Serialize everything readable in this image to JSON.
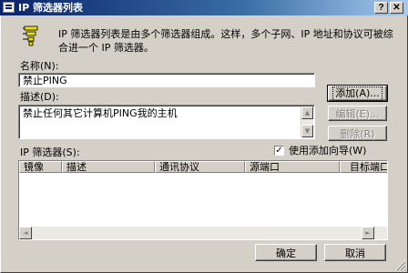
{
  "window": {
    "title": "IP 筛选器列表",
    "help_glyph": "?",
    "close_glyph": "✕"
  },
  "intro": {
    "text": "IP 筛选器列表是由多个筛选器组成。这样，多个子网、IP 地址和协议可被综合进一个 IP 筛选器。"
  },
  "name_field": {
    "label": "名称",
    "shortcut": "(N):",
    "value": "禁止PING"
  },
  "description_field": {
    "label": "描述",
    "shortcut": "(D):",
    "value": "禁止任何其它计算机PING我的主机"
  },
  "buttons": {
    "add": "添加(A)...",
    "edit": "编辑(E)...",
    "remove": "删除(R)",
    "ok": "确定",
    "cancel": "取消"
  },
  "filters": {
    "label": "IP 筛选器",
    "shortcut": "(S):",
    "columns": [
      "镜像",
      "描述",
      "通讯协议",
      "源端口",
      "目标端口"
    ],
    "rows": []
  },
  "wizard": {
    "label": "使用添加向导",
    "shortcut": "(W)",
    "checked": true,
    "check_glyph": "✓"
  },
  "arrows": {
    "up": "▲",
    "down": "▼",
    "left": "◄",
    "right": "►"
  },
  "colors": {
    "titlebar_start": "#0a246a",
    "titlebar_end": "#a6caf0",
    "face": "#d4d0c8"
  }
}
